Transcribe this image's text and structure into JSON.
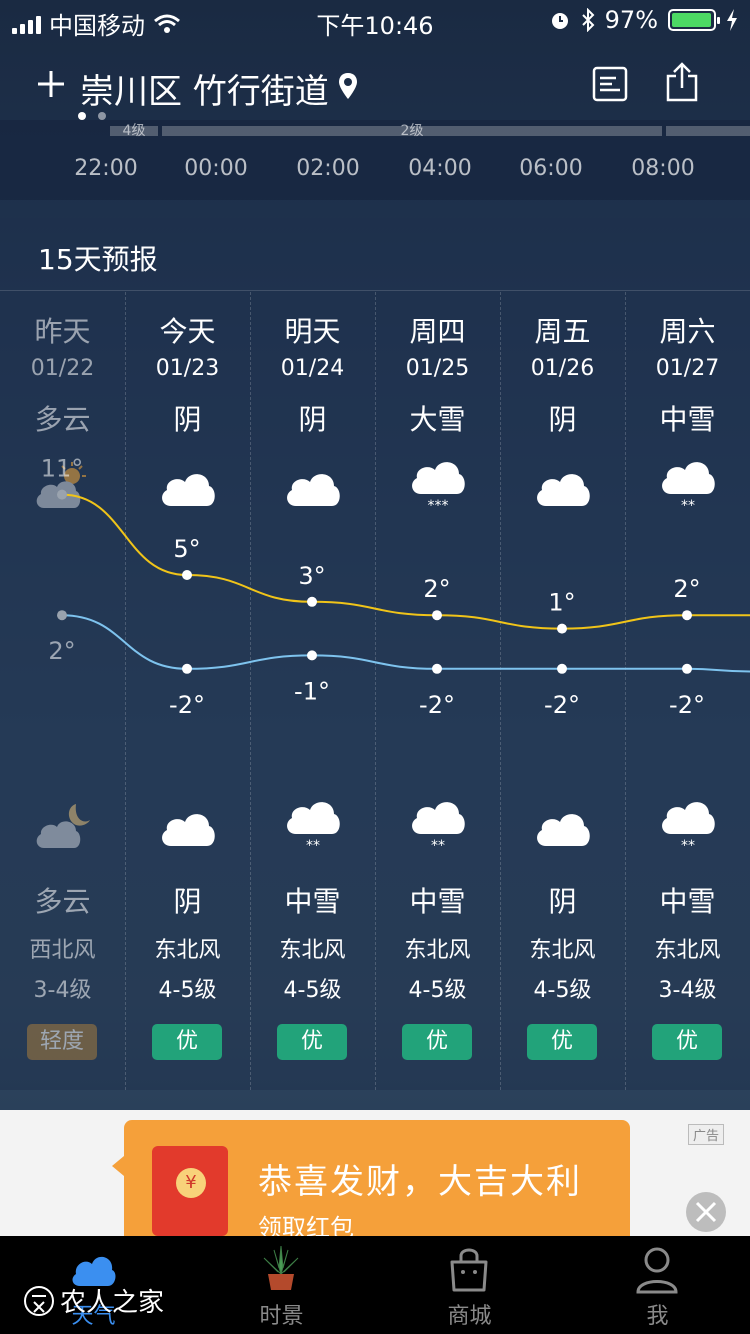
{
  "status_bar": {
    "carrier": "中国移动",
    "time": "下午10:46",
    "battery": "97%",
    "battery_level": 0.97
  },
  "header": {
    "add_icon": "plus-icon",
    "city": "崇川区 竹行街道",
    "location_icon": "location-pin-icon",
    "report_icon": "report-icon",
    "share_icon": "share-icon",
    "page_count": 2,
    "active_page": 0
  },
  "hourly": {
    "wind_labels": [
      "4级",
      "2级"
    ],
    "hours": [
      "22:00",
      "00:00",
      "02:00",
      "04:00",
      "06:00",
      "08:00"
    ]
  },
  "forecast": {
    "title": "15天预报",
    "days": [
      {
        "name": "昨天",
        "date": "01/22",
        "day_cond": "多云",
        "day_icon": "partly-cloudy-day-icon",
        "high": "11°",
        "low": "2°",
        "night_icon": "partly-cloudy-night-icon",
        "night_cond": "多云",
        "wind_dir": "西北风",
        "wind_lvl": "3-4级",
        "aqi": "轻度",
        "aqi_color": "#a67c3e",
        "past": true
      },
      {
        "name": "今天",
        "date": "01/23",
        "day_cond": "阴",
        "day_icon": "cloudy-icon",
        "high": "5°",
        "low": "-2°",
        "night_icon": "cloudy-icon",
        "night_cond": "阴",
        "wind_dir": "东北风",
        "wind_lvl": "4-5级",
        "aqi": "优",
        "aqi_color": "#22a37a",
        "past": false
      },
      {
        "name": "明天",
        "date": "01/24",
        "day_cond": "阴",
        "day_icon": "cloudy-icon",
        "high": "3°",
        "low": "-1°",
        "night_icon": "moderate-snow-icon",
        "night_cond": "中雪",
        "wind_dir": "东北风",
        "wind_lvl": "4-5级",
        "aqi": "优",
        "aqi_color": "#22a37a",
        "past": false
      },
      {
        "name": "周四",
        "date": "01/25",
        "day_cond": "大雪",
        "day_icon": "heavy-snow-icon",
        "high": "2°",
        "low": "-2°",
        "night_icon": "moderate-snow-icon",
        "night_cond": "中雪",
        "wind_dir": "东北风",
        "wind_lvl": "4-5级",
        "aqi": "优",
        "aqi_color": "#22a37a",
        "past": false
      },
      {
        "name": "周五",
        "date": "01/26",
        "day_cond": "阴",
        "day_icon": "cloudy-icon",
        "high": "1°",
        "low": "-2°",
        "night_icon": "cloudy-icon",
        "night_cond": "阴",
        "wind_dir": "东北风",
        "wind_lvl": "4-5级",
        "aqi": "优",
        "aqi_color": "#22a37a",
        "past": false
      },
      {
        "name": "周六",
        "date": "01/27",
        "day_cond": "中雪",
        "day_icon": "moderate-snow-icon",
        "high": "2°",
        "low": "-2°",
        "night_icon": "moderate-snow-icon",
        "night_cond": "中雪",
        "wind_dir": "东北风",
        "wind_lvl": "3-4级",
        "aqi": "优",
        "aqi_color": "#22a37a",
        "past": false
      }
    ],
    "high_values": [
      11,
      5,
      3,
      2,
      1,
      2
    ],
    "low_values": [
      2,
      -2,
      -1,
      -2,
      -2,
      -2
    ],
    "high_color": "#f0c419",
    "low_color": "#7ec3ee"
  },
  "ad": {
    "title": "恭喜发财，大吉大利",
    "subtitle": "领取红包",
    "tag": "广告",
    "coin_symbol": "¥",
    "close_icon": "close-icon"
  },
  "tabbar": {
    "items": [
      {
        "label": "天气",
        "icon": "cloud-icon",
        "active": true
      },
      {
        "label": "时景",
        "icon": "plant-icon",
        "active": false
      },
      {
        "label": "商城",
        "icon": "shopping-bag-icon",
        "active": false
      },
      {
        "label": "我",
        "icon": "user-icon",
        "active": false
      }
    ],
    "watermark": "农人之家"
  }
}
